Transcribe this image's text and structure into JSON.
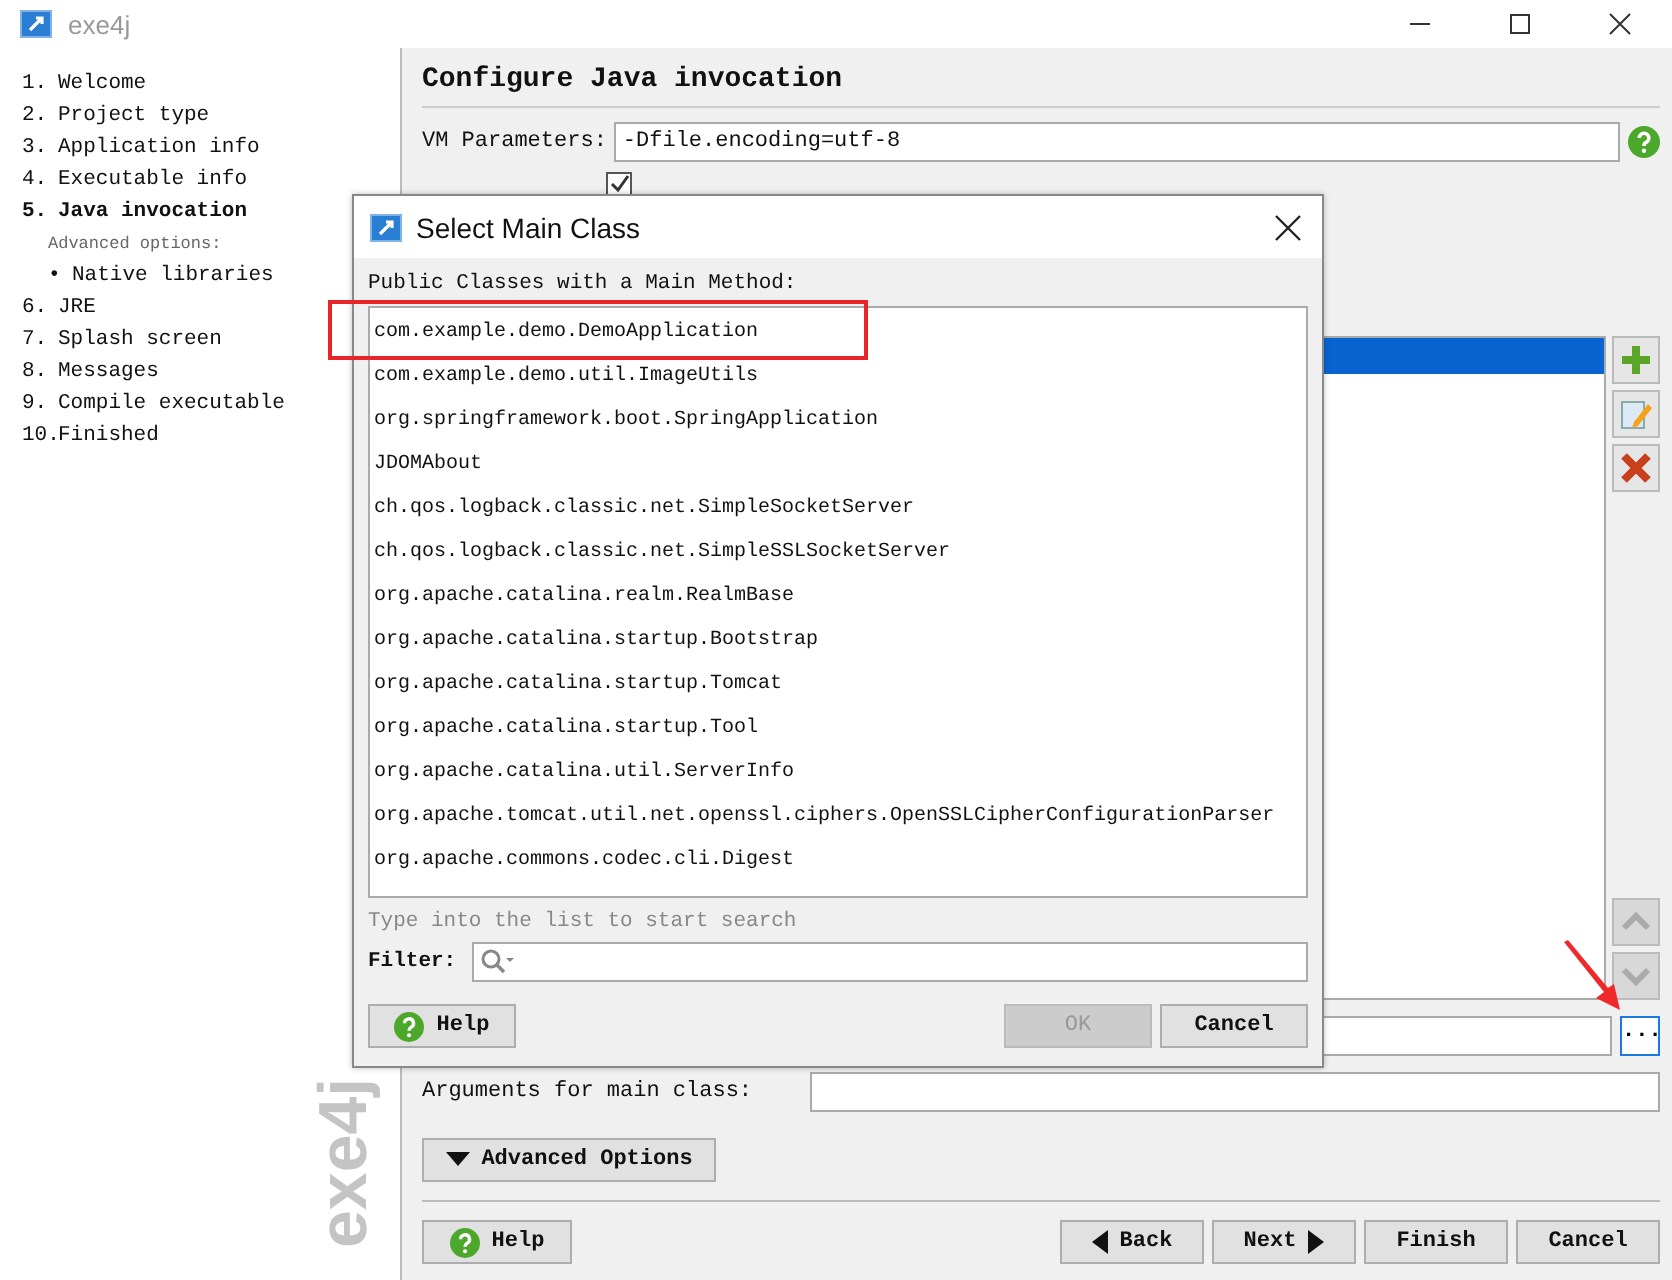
{
  "window": {
    "title": "exe4j"
  },
  "sidebar": {
    "steps": [
      {
        "kind": "step",
        "number": "1.",
        "label": "Welcome",
        "selected": false
      },
      {
        "kind": "step",
        "number": "2.",
        "label": "Project type",
        "selected": false
      },
      {
        "kind": "step",
        "number": "3.",
        "label": "Application info",
        "selected": false
      },
      {
        "kind": "step",
        "number": "4.",
        "label": "Executable info",
        "selected": false
      },
      {
        "kind": "step",
        "number": "5.",
        "label": "Java invocation",
        "selected": true
      },
      {
        "kind": "heading",
        "label": "Advanced options:",
        "selected": false
      },
      {
        "kind": "sub",
        "number": "•",
        "label": "Native libraries",
        "selected": false
      },
      {
        "kind": "step",
        "number": "6.",
        "label": "JRE",
        "selected": false
      },
      {
        "kind": "step",
        "number": "7.",
        "label": "Splash screen",
        "selected": false
      },
      {
        "kind": "step",
        "number": "8.",
        "label": "Messages",
        "selected": false
      },
      {
        "kind": "step",
        "number": "9.",
        "label": "Compile executable",
        "selected": false
      },
      {
        "kind": "step",
        "number": "10.",
        "label": "Finished",
        "selected": false
      }
    ],
    "logo": "exe4j"
  },
  "main": {
    "heading": "Configure Java invocation",
    "vm_label": "VM Parameters:",
    "vm_value": "-Dfile.encoding=utf-8",
    "passthrough_checked": true,
    "classpath_rows": [
      {
        "selected": true
      }
    ],
    "browse_button": "...",
    "args_label": "Arguments for main class:",
    "advanced_button": "Advanced Options",
    "buttons": [
      {
        "kind": "help",
        "label": "Help"
      },
      {
        "kind": "back",
        "label": "Back"
      },
      {
        "kind": "next",
        "label": "Next"
      },
      {
        "kind": "plain",
        "label": "Finish"
      },
      {
        "kind": "plain",
        "label": "Cancel"
      }
    ]
  },
  "dialog": {
    "title": "Select Main Class",
    "list_label": "Public Classes with a Main Method:",
    "classes": [
      {
        "name": "com.example.demo.DemoApplication",
        "highlighted": true
      },
      {
        "name": "com.example.demo.util.ImageUtils",
        "highlighted": false
      },
      {
        "name": "org.springframework.boot.SpringApplication",
        "highlighted": false
      },
      {
        "name": "JDOMAbout",
        "highlighted": false
      },
      {
        "name": "ch.qos.logback.classic.net.SimpleSocketServer",
        "highlighted": false
      },
      {
        "name": "ch.qos.logback.classic.net.SimpleSSLSocketServer",
        "highlighted": false
      },
      {
        "name": "org.apache.catalina.realm.RealmBase",
        "highlighted": false
      },
      {
        "name": "org.apache.catalina.startup.Bootstrap",
        "highlighted": false
      },
      {
        "name": "org.apache.catalina.startup.Tomcat",
        "highlighted": false
      },
      {
        "name": "org.apache.catalina.startup.Tool",
        "highlighted": false
      },
      {
        "name": "org.apache.catalina.util.ServerInfo",
        "highlighted": false
      },
      {
        "name": "org.apache.tomcat.util.net.openssl.ciphers.OpenSSLCipherConfigurationParser",
        "highlighted": false
      },
      {
        "name": "org.apache.commons.codec.cli.Digest",
        "highlighted": false
      }
    ],
    "hint": "Type into the list to start search",
    "filter_label": "Filter:",
    "buttons": [
      {
        "kind": "help",
        "label": "Help",
        "disabled": false
      },
      {
        "kind": "plain",
        "label": "OK",
        "disabled": true
      },
      {
        "kind": "plain",
        "label": "Cancel",
        "disabled": false
      }
    ]
  },
  "pointer_arrow": true
}
